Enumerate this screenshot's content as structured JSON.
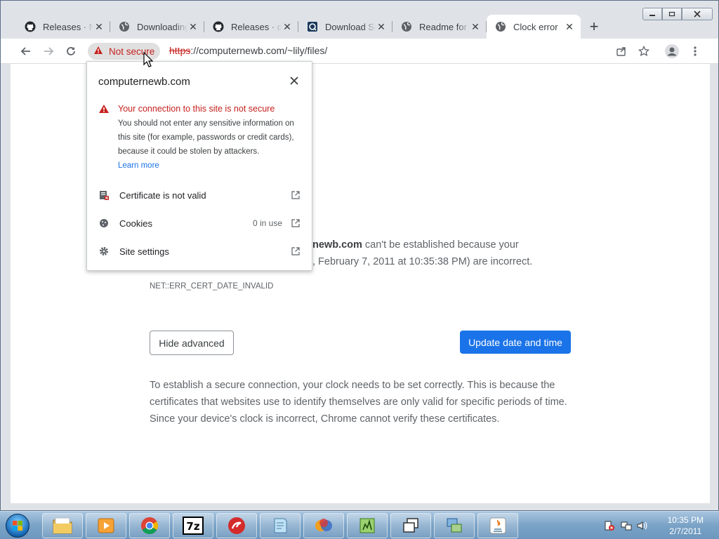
{
  "window": {
    "controls": {
      "minimize": "▭",
      "maximize": "▢",
      "close": "✕"
    }
  },
  "tabs": [
    {
      "title": "Releases · Na",
      "icon": "github-icon"
    },
    {
      "title": "Downloading",
      "icon": "globe-icon"
    },
    {
      "title": "Releases · dn",
      "icon": "github-icon"
    },
    {
      "title": "Download St",
      "icon": "app-icon"
    },
    {
      "title": "Readme for V",
      "icon": "globe-icon"
    },
    {
      "title": "Clock error",
      "icon": "globe-icon",
      "active": true
    }
  ],
  "toolbar": {
    "security_label": "Not secure",
    "url_scheme": "https",
    "url_rest": "://computernewb.com/~lily/files/"
  },
  "popup": {
    "host": "computernewb.com",
    "warning_title": "Your connection to this site is not secure",
    "warning_body": "You should not enter any sensitive information on this site (for example, passwords or credit cards), because it could be stolen by attackers.",
    "learn_more": "Learn more",
    "rows": [
      {
        "label": "Certificate is not valid",
        "value": ""
      },
      {
        "label": "Cookies",
        "value": "0 in use"
      },
      {
        "label": "Site settings",
        "value": ""
      }
    ]
  },
  "page": {
    "line1_bold": "newb.com",
    "line1_rest": " can't be established because your",
    "line2": ", February 7, 2011 at 10:35:38 PM) are incorrect.",
    "error_code": "NET::ERR_CERT_DATE_INVALID",
    "hide_advanced": "Hide advanced",
    "update_button": "Update date and time",
    "explanation": "To establish a secure connection, your clock needs to be set correctly. This is because the certificates that websites use to identify themselves are only valid for specific periods of time. Since your device's clock is incorrect, Chrome cannot verify these certificates."
  },
  "taskbar": {
    "time": "10:35 PM",
    "date": "2/7/2011"
  },
  "colors": {
    "danger": "#c5221f",
    "accent": "#1a73e8"
  }
}
